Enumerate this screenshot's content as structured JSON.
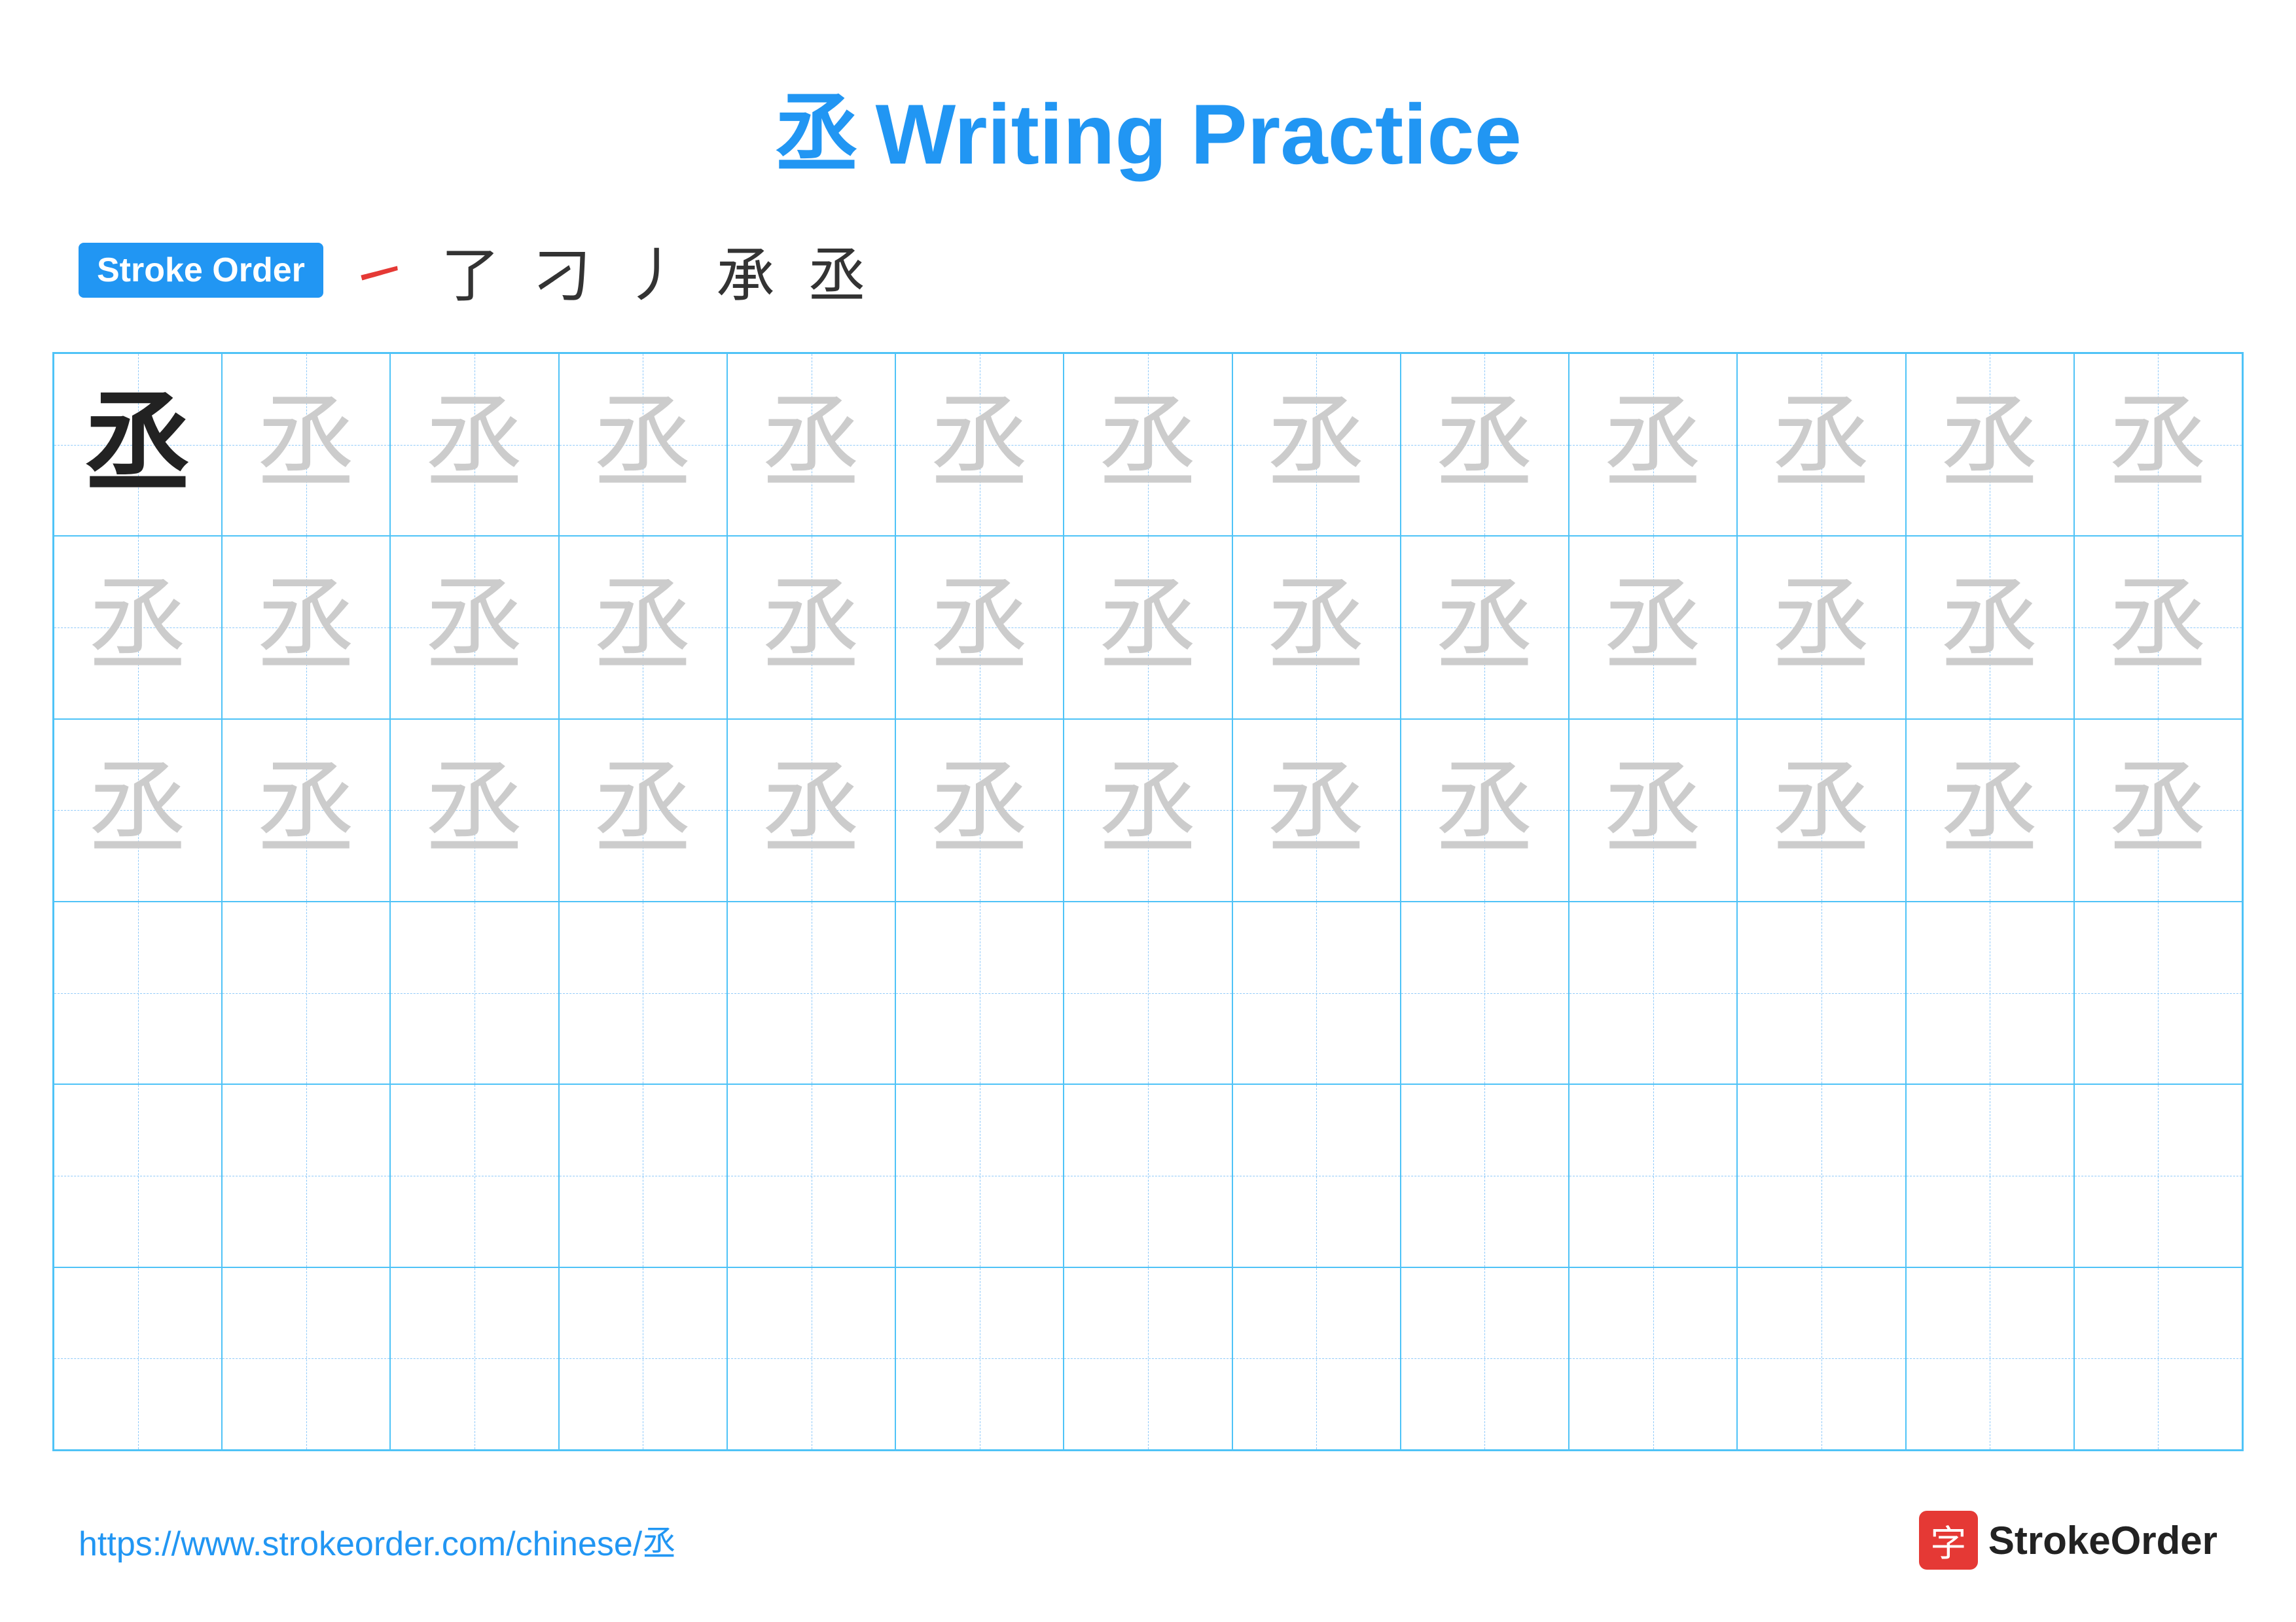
{
  "page": {
    "title": {
      "char": "丞",
      "text": "Writing Practice"
    },
    "stroke_order": {
      "badge_label": "Stroke Order",
      "strokes": [
        "㇀",
        "了",
        "刁",
        "丿",
        "承",
        "丞"
      ]
    },
    "grid": {
      "rows": 6,
      "cols": 13,
      "chars": {
        "dark": "丞",
        "light": "丞"
      }
    },
    "footer": {
      "url": "https://www.strokeorder.com/chinese/丞",
      "logo_char": "字",
      "logo_text": "StrokeOrder"
    }
  }
}
